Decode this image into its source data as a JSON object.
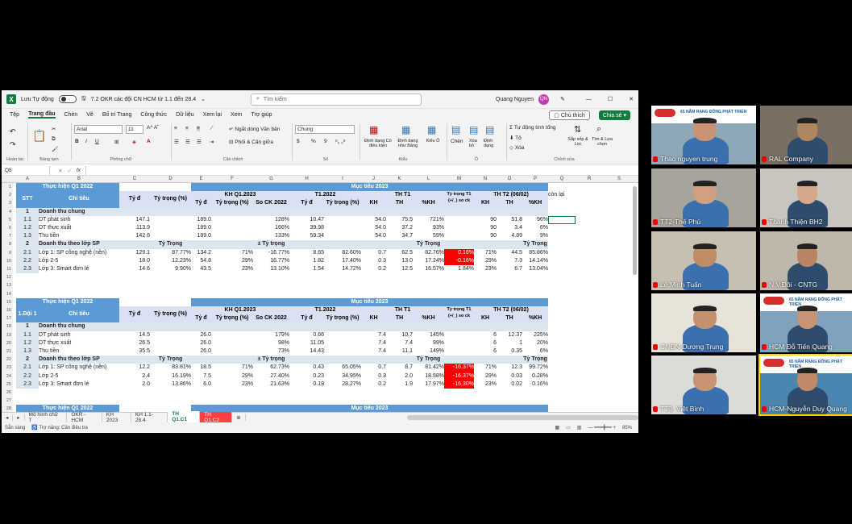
{
  "window": {
    "autosave_label": "Lưu Tự động",
    "file_title": "7.2 OKR các đội CN HCM từ 1.1 đến 28.4",
    "search_placeholder": "Tìm kiếm",
    "user_name": "Quang Nguyen",
    "user_initials": "QN"
  },
  "menu": {
    "tabs": [
      "Tệp",
      "Trang đầu",
      "Chèn",
      "Vẽ",
      "Bố trí Trang",
      "Công thức",
      "Dữ liệu",
      "Xem lại",
      "Xem",
      "Trợ giúp"
    ],
    "active": "Trang đầu",
    "comment_btn": "Chú thích",
    "share_btn": "Chia sẻ"
  },
  "ribbon": {
    "undo_group": "Hoàn tác",
    "clipboard_group": "Bảng tạm",
    "font_group": "Phông chữ",
    "align_group": "Căn chỉnh",
    "number_group": "Số",
    "styles_group": "Kiểu",
    "cells_group": "Ô",
    "edit_group": "Chỉnh sửa",
    "font_name": "Arial",
    "font_size": "11",
    "wrap_text": "Ngắt dòng Văn bản",
    "merge_center": "Phối & Căn giữa",
    "number_format": "Chung",
    "cond_format": "Định dạng Có điều kiện",
    "format_table": "Định dạng như Bảng",
    "cell_styles": "Kiểu Ô",
    "insert": "Chèn",
    "delete": "Xóa bỏ",
    "format": "Định dạng",
    "autosum": "Tự động tính tổng",
    "fill": "Tô",
    "clear": "Xóa",
    "sort_filter": "Sắp xếp & Lọc",
    "find_select": "Tìm & Lựa chọn",
    "percent": "%",
    "comma": "9",
    "currency": "$"
  },
  "formula_bar": {
    "name_box": "Q5",
    "fx": "fx"
  },
  "columns": [
    "A",
    "B",
    "C",
    "D",
    "E",
    "F",
    "G",
    "H",
    "I",
    "J",
    "K",
    "L",
    "M",
    "N",
    "O",
    "P",
    "Q",
    "R",
    "S"
  ],
  "sheet": {
    "top_hdr": {
      "th_q1": "Thực hiện Q1 2022",
      "muc_tieu": "Mục tiêu 2023",
      "stt": "STT",
      "chi_tieu": "Chỉ tiêu",
      "ty_d": "Tỷ đ",
      "ty_trong": "Tỷ trọng (%)",
      "kh_q1": "KH Q1.2023",
      "ty_d2": "Tỷ đ",
      "ty_trong2": "Tỷ trọng (%)",
      "so_ck": "So CK 2022",
      "t1_2022": "T1.2022",
      "ty_d3": "Tỷ đ",
      "ty_trong3": "Tỷ trọng (%)",
      "th_t1": "TH T1",
      "kh": "KH",
      "th": "TH",
      "pkh": "%KH",
      "tt_t1": "Tỷ trọng T1 (+/_) so ck",
      "th_t2": "TH T2 (06/02)",
      "kh2": "KH",
      "th2": "TH",
      "pkh2": "%KH",
      "con_lai": "còn lại"
    },
    "block1": [
      {
        "a": "1",
        "b": "Doanh thu chung",
        "type": "sec"
      },
      {
        "a": "1.1",
        "b": "DT phát sinh",
        "c": "147.1",
        "e": "189.0",
        "g": "128%",
        "h": "10.47",
        "j": "54.0",
        "k": "75.5",
        "l": "721%",
        "n": "90",
        "o": "51.8",
        "p": "96%"
      },
      {
        "a": "1.2",
        "b": "DT thực xuất",
        "c": "113.9",
        "e": "189.0",
        "g": "166%",
        "h": "39.98",
        "j": "54.0",
        "k": "37.2",
        "l": "93%",
        "n": "90",
        "o": "3.4",
        "p": "6%"
      },
      {
        "a": "1.3",
        "b": "Thu tiền",
        "c": "142.6",
        "e": "189.0",
        "g": "133%",
        "h": "59.34",
        "j": "54.0",
        "k": "34.7",
        "l": "59%",
        "n": "90",
        "o": "4.89",
        "p": "9%"
      },
      {
        "a": "2",
        "b": "Doanh thu theo lớp SP",
        "d": "Tỷ Trọng",
        "g": "± Tỷ trọng",
        "l": "Tỷ Trọng",
        "p": "Tỷ Trọng",
        "type": "sec2"
      },
      {
        "a": "2.1",
        "b": "Lớp 1: SP công nghệ (nền)",
        "c": "129.1",
        "d": "87.77%",
        "e": "134.2",
        "f": "71%",
        "g": "-16.77%",
        "h": "8.65",
        "i": "82.60%",
        "j": "0.7",
        "k": "62.5",
        "l": "82.76%",
        "m": "0.16%",
        "n": "71%",
        "o": "44.5",
        "p": "85.86%"
      },
      {
        "a": "2.2",
        "b": "Lớp 2-5",
        "c": "18.0",
        "d": "12.23%",
        "e": "54.8",
        "f": "29%",
        "g": "16.77%",
        "h": "1.82",
        "i": "17.40%",
        "j": "0.3",
        "k": "13.0",
        "l": "17.24%",
        "m": "-0.16%",
        "n": "29%",
        "o": "7.3",
        "p": "14.14%"
      },
      {
        "a": "2.3",
        "b": "Lớp 3: Smart đơn lẻ",
        "c": "14.6",
        "d": "9.90%",
        "e": "43.5",
        "f": "23%",
        "g": "13.10%",
        "h": "1.54",
        "i": "14.72%",
        "j": "0.2",
        "k": "12.5",
        "l": "16.57%",
        "m": "1.84%",
        "n": "23%",
        "o": "6.7",
        "p": "13.04%"
      }
    ],
    "block2_hdr": {
      "doi": "1.Đội 1",
      "chi_tieu": "Chỉ tiêu"
    },
    "block2": [
      {
        "a": "1",
        "b": "Doanh thu chung",
        "type": "sec"
      },
      {
        "a": "1.1",
        "b": "DT phát sinh",
        "c": "14.5",
        "e": "26.0",
        "g": "179%",
        "h": "0.66",
        "j": "7.4",
        "k": "10.7",
        "l": "145%",
        "n": "6",
        "o": "12.37",
        "p": "225%"
      },
      {
        "a": "1.2",
        "b": "DT thực xuất",
        "c": "26.5",
        "e": "26.0",
        "g": "98%",
        "h": "11.05",
        "j": "7.4",
        "k": "7.4",
        "l": "99%",
        "n": "6",
        "o": "1",
        "p": "20%"
      },
      {
        "a": "1.3",
        "b": "Thu tiền",
        "c": "35.5",
        "e": "26.0",
        "g": "73%",
        "h": "14.43",
        "j": "7.4",
        "k": "11.1",
        "l": "149%",
        "n": "6",
        "o": "0.35",
        "p": "6%"
      },
      {
        "a": "2",
        "b": "Doanh thu theo lớp SP",
        "d": "Tỷ Trọng",
        "g": "± Tỷ trọng",
        "l": "Tỷ Trọng",
        "p": "Tỷ Trọng",
        "type": "sec2"
      },
      {
        "a": "2.1",
        "b": "Lớp 1: SP công nghệ (nền)",
        "c": "12.2",
        "d": "83.81%",
        "e": "18.5",
        "f": "71%",
        "g": "62.73%",
        "h": "0.43",
        "i": "65.05%",
        "j": "0.7",
        "k": "8.7",
        "l": "81.42%",
        "m": "-16.37%",
        "n": "71%",
        "o": "12.3",
        "p": "99.72%"
      },
      {
        "a": "2.2",
        "b": "Lớp 2-5",
        "c": "2.4",
        "d": "16.19%",
        "e": "7.5",
        "f": "29%",
        "g": "27.40%",
        "h": "0.23",
        "i": "34.95%",
        "j": "0.3",
        "k": "2.0",
        "l": "18.58%",
        "m": "-16.37%",
        "n": "29%",
        "o": "0.03",
        "p": "0.28%"
      },
      {
        "a": "2.3",
        "b": "Lớp 3: Smart đơn lẻ",
        "c": "2.0",
        "d": "13.86%",
        "e": "6.0",
        "f": "23%",
        "g": "21.63%",
        "h": "0.19",
        "i": "28.27%",
        "j": "0.2",
        "k": "1.9",
        "l": "17.97%",
        "m": "-16.30%",
        "n": "23%",
        "o": "0.02",
        "p": "0.16%"
      }
    ]
  },
  "sheet_tabs": [
    "Mô hình chữ T",
    "OKR -HCM",
    "KH 2023",
    "KH 1.1-28.4",
    "TH Q1.C1",
    "TH Q1.C2"
  ],
  "active_tab": "TH Q1.C1",
  "status": {
    "ready": "Sẵn sàng",
    "accessibility": "Trợ năng: Cần điều tra",
    "zoom": "85%"
  },
  "participants": [
    "Thao nguyen trung",
    "RAL Company",
    "TT2-Thế Phú",
    "Thanh Thiện BH2",
    "Lê Minh Tuấn",
    "N.V.Đôi - CNTG",
    "CNĐN-Dương Trung",
    "HCM Đỗ Tiến Quang",
    "TT3. Việt Bình",
    "HCM-Nguyễn Duy Quang"
  ],
  "banner_text": "65 NĂM RẠNG ĐÔNG PHÁT TRIỂN"
}
